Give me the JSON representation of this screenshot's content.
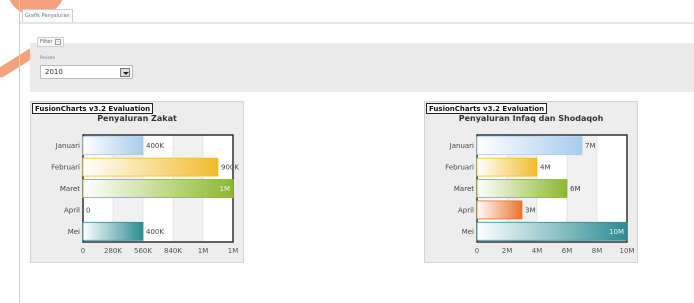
{
  "tabs": [
    {
      "label": "Grafik Penyaluran"
    }
  ],
  "filter": {
    "legend": "Filter",
    "collapse_symbol": "–",
    "periode_label": "Periode",
    "periode_value": "2010"
  },
  "charts": [
    {
      "badge": "FusionCharts v3.2 Evaluation",
      "chart_data": {
        "type": "bar",
        "title": "Penyaluran Zakat",
        "categories": [
          "Januari",
          "Februari",
          "Maret",
          "April",
          "Mei"
        ],
        "values": [
          400000,
          900000,
          1000000,
          0,
          400000
        ],
        "value_labels": [
          "400K",
          "900K",
          "1M",
          "0",
          "400K"
        ],
        "xlim": [
          0,
          1000000
        ],
        "x_ticks": [
          "0",
          "280K",
          "560K",
          "840K",
          "1M",
          "1M"
        ],
        "grid": true,
        "bar_colors": [
          "#a8ccec",
          "#f0bc2e",
          "#8cb830",
          "#e8742c",
          "#2c8c94"
        ]
      }
    },
    {
      "badge": "FusionCharts v3.2 Evaluation",
      "chart_data": {
        "type": "bar",
        "title": "Penyaluran Infaq dan Shodaqoh",
        "categories": [
          "Januari",
          "Februari",
          "Maret",
          "April",
          "Mei"
        ],
        "values": [
          7000000,
          4000000,
          6000000,
          3000000,
          10000000
        ],
        "value_labels": [
          "7M",
          "4M",
          "6M",
          "3M",
          "10M"
        ],
        "xlim": [
          0,
          10000000
        ],
        "x_ticks": [
          "0",
          "2M",
          "4M",
          "6M",
          "8M",
          "10M"
        ],
        "grid": true,
        "bar_colors": [
          "#a8ccec",
          "#f0bc2e",
          "#8cb830",
          "#e8742c",
          "#2c8c94"
        ]
      }
    }
  ]
}
